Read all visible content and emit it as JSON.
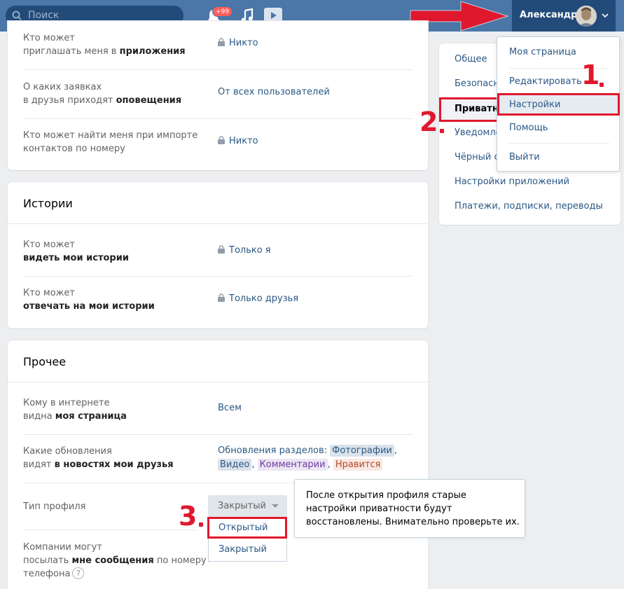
{
  "header": {
    "search_placeholder": "Поиск",
    "notifications_badge": "+99",
    "user_name": "Александр"
  },
  "user_menu": {
    "items": [
      {
        "label": "Моя страница"
      },
      {
        "label": "Редактировать"
      },
      {
        "label": "Настройки"
      },
      {
        "label": "Помощь"
      },
      {
        "label": "Выйти"
      }
    ],
    "highlighted": "Настройки"
  },
  "settings_nav": {
    "items": [
      {
        "label": "Общее"
      },
      {
        "label": "Безопасность"
      },
      {
        "label": "Приватность"
      },
      {
        "label": "Уведомления"
      },
      {
        "label": "Чёрный список"
      },
      {
        "label": "Настройки приложений"
      },
      {
        "label": "Платежи, подписки, переводы"
      }
    ],
    "active": "Приватность"
  },
  "top_section": {
    "rows": [
      {
        "label_1": "Кто может",
        "label_2_plain": "приглашать меня в ",
        "label_2_bold": "приложения",
        "value": "Никто",
        "locked": true
      },
      {
        "label_1": "О каких заявках",
        "label_2_plain": "в друзья приходят ",
        "label_2_bold": "оповещения",
        "value": "От всех пользователей",
        "locked": false
      },
      {
        "label_1": "Кто может найти меня при импорте",
        "label_2_plain": "контактов по номеру",
        "label_2_bold": "",
        "value": "Никто",
        "locked": true
      }
    ]
  },
  "stories": {
    "title": "Истории",
    "rows": [
      {
        "label_1": "Кто может",
        "label_2_bold": "видеть мои истории",
        "value": "Только я"
      },
      {
        "label_1": "Кто может",
        "label_2_bold": "отвечать на мои истории",
        "value": "Только друзья"
      }
    ]
  },
  "other": {
    "title": "Прочее",
    "page_visibility": {
      "label_1": "Кому в интернете",
      "label_2_plain": "видна ",
      "label_2_bold": "моя страница",
      "value": "Всем"
    },
    "feed_updates": {
      "label_1": "Какие обновления",
      "label_2_plain": "видят ",
      "label_2_bold": "в новостях мои друзья",
      "prefix": "Обновления разделов:",
      "tags": [
        "Фотографии",
        "Видео",
        "Комментарии",
        "Нравится"
      ]
    },
    "profile_type": {
      "label": "Тип профиля",
      "selected": "Закрытый",
      "options": [
        "Открытый",
        "Закрытый"
      ]
    },
    "company_messages": {
      "label_1": "Компании могут",
      "label_2_plain": "посылать ",
      "label_2_bold": "мне сообщения",
      "label_2_tail": " по номеру",
      "label_3": "телефона",
      "help": "?"
    },
    "tooltip": "После открытия профиля старые настройки приватности будут восстановлены. Внимательно проверьте их."
  },
  "annotations": {
    "step1": "1",
    "step2": "2",
    "step3": "3",
    "color": "#e0182d"
  },
  "colors": {
    "header_bg": "#4a76a8",
    "header_dark": "#224b7a",
    "link": "#2a5885",
    "page_bg": "#edeef0"
  }
}
